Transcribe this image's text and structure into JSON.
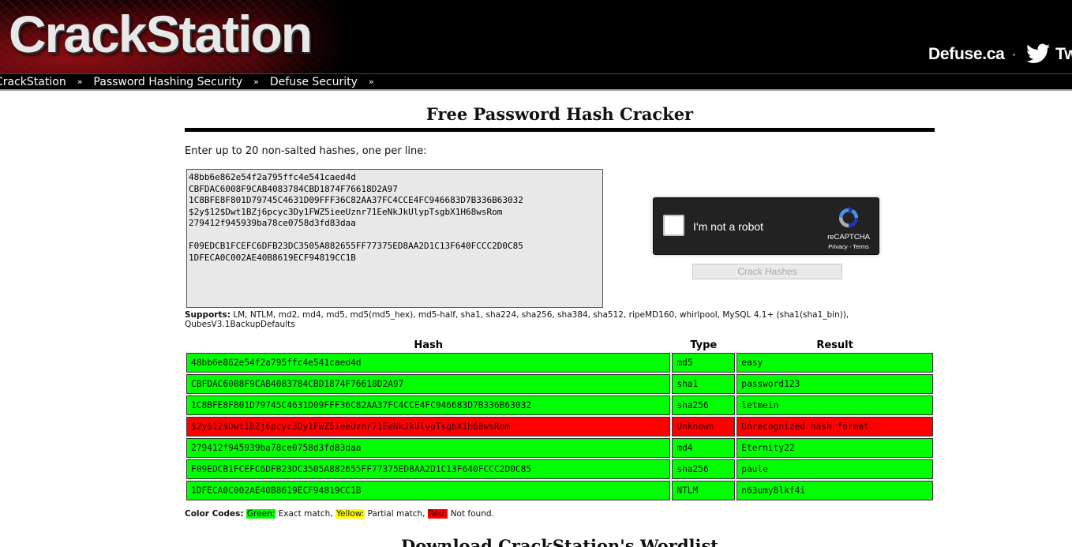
{
  "header": {
    "logo_text": "CrackStation",
    "defuse_link": "Defuse.ca",
    "separator": "·",
    "twitter_text": "Tw"
  },
  "nav": {
    "items": [
      {
        "label": "CrackStation",
        "icon": "double-chevron-down-icon"
      },
      {
        "label": "Password Hashing Security",
        "icon": "double-chevron-down-icon"
      },
      {
        "label": "Defuse Security",
        "icon": "double-chevron-down-icon"
      }
    ]
  },
  "main": {
    "title": "Free Password Hash Cracker",
    "instructions": "Enter up to 20 non-salted hashes, one per line:",
    "hash_input_value": "48bb6e862e54f2a795ffc4e541caed4d\nCBFDAC6008F9CAB4083784CBD1874F76618D2A97\n1C8BFE8F801D79745C4631D09FFF36C82AA37FC4CCE4FC946683D7B336B63032\n$2y$12$Dwt1BZj6pcyc3Dy1FWZ5ieeUznr71EeNkJkUlypTsgbX1H68wsRom\n279412f945939ba78ce0758d3fd83daa\n\nF09EDCB1FCEFC6DFB23DC3505A882655FF77375ED8AA2D1C13F640FCCC2D0C85\n1DFECA0C002AE40B8619ECF94819CC1B",
    "recaptcha": {
      "label": "I'm not a robot",
      "brand": "reCAPTCHA",
      "terms": "Privacy - Terms"
    },
    "crack_button_label": "Crack Hashes",
    "supports_label": "Supports:",
    "supports_text": " LM, NTLM, md2, md4, md5, md5(md5_hex), md5-half, sha1, sha224, sha256, sha384, sha512, ripeMD160, whirlpool, MySQL 4.1+ (sha1(sha1_bin)), QubesV3.1BackupDefaults"
  },
  "results": {
    "headers": {
      "hash": "Hash",
      "type": "Type",
      "result": "Result"
    },
    "rows": [
      {
        "hash": "48bb6e862e54f2a795ffc4e541caed4d",
        "type": "md5",
        "result": "easy",
        "status": "green"
      },
      {
        "hash": "CBFDAC6008F9CAB4083784CBD1874F76618D2A97",
        "type": "sha1",
        "result": "password123",
        "status": "green"
      },
      {
        "hash": "1C8BFE8F801D79745C4631D09FFF36C82AA37FC4CCE4FC946683D7B336B63032",
        "type": "sha256",
        "result": "letmein",
        "status": "green"
      },
      {
        "hash": "$2y$12$Dwt1BZj6pcyc3Dy1FWZ5ieeUznr71EeNkJkUlypTsgbX1H68wsRom",
        "type": "Unknown",
        "result": "Unrecognized hash format.",
        "status": "red"
      },
      {
        "hash": "279412f945939ba78ce0758d3fd83daa",
        "type": "md4",
        "result": "Eternity22",
        "status": "green"
      },
      {
        "hash": "F09EDCB1FCEFC6DFB23DC3505A882655FF77375ED8AA2D1C13F640FCCC2D0C85",
        "type": "sha256",
        "result": "paule",
        "status": "green"
      },
      {
        "hash": "1DFECA0C002AE40B8619ECF94819CC1B",
        "type": "NTLM",
        "result": "n63umy8lkf4i",
        "status": "green"
      }
    ]
  },
  "color_codes": {
    "label": "Color Codes:",
    "green": "Green:",
    "green_desc": " Exact match, ",
    "yellow": "Yellow:",
    "yellow_desc": " Partial match, ",
    "red": "Red:",
    "red_desc": " Not found."
  },
  "wordlist": {
    "heading": "Download CrackStation's Wordlist"
  },
  "colors": {
    "match_green": "#00ff00",
    "partial_yellow": "#ffff00",
    "not_found_red": "#ff0000"
  }
}
